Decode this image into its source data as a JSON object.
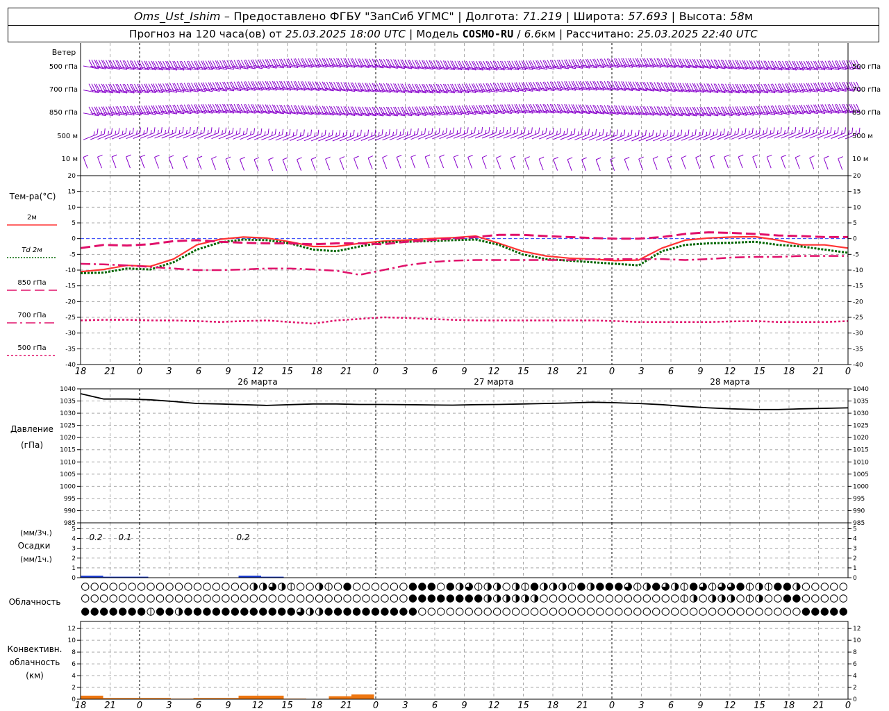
{
  "header": {
    "station": "Oms_Ust_Ishim",
    "dash": "–",
    "provided_by": "Предоставлено ФГБУ \"ЗапСиб УГМС\"",
    "lon_label": "Долгота:",
    "lon_value": "71.219",
    "lat_label": "Широта:",
    "lat_value": "57.693",
    "alt_label": "Высота:",
    "alt_value": "58",
    "alt_unit": "м",
    "sep": "|",
    "forecast_label": "Прогноз на 120 часа(ов) от",
    "forecast_start": "25.03.2025 18:00 UTC",
    "model_label": "Модель",
    "model_name": "COSMO-RU",
    "model_slash": "/",
    "model_res": "6.6",
    "model_res_unit": "км",
    "computed_label": "Рассчитано:",
    "computed_time": "25.03.2025 22:40 UTC"
  },
  "panels": {
    "wind": {
      "title": "Ветер",
      "levels": [
        "500 гПа",
        "700 гПа",
        "850 гПа",
        "500 м",
        "10  м"
      ],
      "color": "#8800cc"
    },
    "temperature": {
      "title": "Тем-ра(°С)",
      "legend": [
        {
          "label": "2м",
          "color": "#ff3333",
          "dash": "solid"
        },
        {
          "label": "Td  2м",
          "color": "#006600",
          "dash": "dot"
        },
        {
          "label": "850 гПа",
          "color": "#e0106a",
          "dash": "longdash"
        },
        {
          "label": "700 гПа",
          "color": "#e0106a",
          "dash": "dashdot"
        },
        {
          "label": "500 гПа",
          "color": "#e0106a",
          "dash": "shortdot"
        }
      ],
      "yticks": [
        20,
        15,
        10,
        5,
        0,
        -5,
        -10,
        -15,
        -20,
        -25,
        -30,
        -35,
        -40
      ]
    },
    "pressure": {
      "title": "Давление",
      "unit": "(гПа)",
      "yticks": [
        1040,
        1035,
        1030,
        1025,
        1020,
        1015,
        1010,
        1005,
        1000,
        995,
        990,
        985
      ]
    },
    "precip": {
      "label_top": "(мм/3ч.)",
      "title": "Осадки",
      "label_bottom": "(мм/1ч.)",
      "yticks": [
        5,
        4,
        3,
        2,
        1,
        0
      ],
      "annotations": [
        "0.2",
        "0.1",
        "0.2"
      ]
    },
    "clouds": {
      "title": "Облачность"
    },
    "convective": {
      "title_lines": [
        "Конвективн.",
        "облачность",
        "(км)"
      ],
      "yticks": [
        12,
        10,
        8,
        6,
        4,
        2,
        0
      ]
    }
  },
  "time_axis": {
    "hour_labels": [
      "18",
      "21",
      "0",
      "3",
      "6",
      "9",
      "12",
      "15",
      "18",
      "21",
      "0",
      "3",
      "6",
      "9",
      "12",
      "15",
      "18",
      "21",
      "0",
      "3",
      "6",
      "9",
      "12",
      "15",
      "18",
      "21",
      "0"
    ],
    "day_labels": [
      "26 марта",
      "27 марта",
      "28 марта"
    ]
  },
  "chart_data": [
    {
      "type": "line",
      "title": "Тем-ра(°С)",
      "x_unit": "hours since 25.03.2025 18:00 UTC",
      "x": [
        0,
        3,
        6,
        9,
        12,
        15,
        18,
        21,
        24,
        27,
        30,
        33,
        36,
        39,
        42,
        45,
        48,
        51,
        54,
        57,
        60,
        63,
        66,
        69,
        72,
        75,
        78
      ],
      "ylim": [
        -40,
        20
      ],
      "series": [
        {
          "name": "2м",
          "values": [
            -10.5,
            -9.8,
            -8.5,
            -8.8,
            -6.5,
            -2.0,
            -0.2,
            0.5,
            0.2,
            -1.0,
            -2.5,
            -2.5,
            -1.5,
            -0.8,
            -0.5,
            0.0,
            0.3,
            0.8,
            -1.5,
            -4.0,
            -5.5,
            -6.2,
            -6.5,
            -7.0,
            -6.8,
            -3.0,
            -0.5,
            0.2,
            0.5,
            0.6,
            -0.5,
            -2.0,
            -2.0,
            -3.0
          ]
        },
        {
          "name": "Td  2м",
          "values": [
            -11.0,
            -10.8,
            -9.5,
            -9.8,
            -7.5,
            -3.5,
            -1.2,
            -0.3,
            -0.5,
            -1.5,
            -3.5,
            -4.0,
            -2.5,
            -1.2,
            -1.0,
            -0.8,
            -0.5,
            -0.3,
            -2.0,
            -5.0,
            -6.5,
            -7.0,
            -7.5,
            -8.0,
            -8.5,
            -4.0,
            -2.0,
            -1.5,
            -1.3,
            -1.0,
            -2.0,
            -2.5,
            -3.5,
            -4.5
          ]
        },
        {
          "name": "850 гПа",
          "values": [
            -3.0,
            -2.0,
            -2.2,
            -1.8,
            -0.8,
            -0.5,
            -1.0,
            -1.3,
            -1.5,
            -1.5,
            -1.8,
            -1.5,
            -1.5,
            -1.8,
            -1.0,
            -0.5,
            0.0,
            0.5,
            1.2,
            1.2,
            0.8,
            0.5,
            0.2,
            0.0,
            0.0,
            0.5,
            1.5,
            2.0,
            1.8,
            1.5,
            1.0,
            0.8,
            0.5,
            0.5
          ]
        },
        {
          "name": "700 гПа",
          "values": [
            -8.0,
            -8.2,
            -8.5,
            -9.0,
            -9.5,
            -10.0,
            -10.0,
            -9.8,
            -9.5,
            -9.5,
            -9.8,
            -10.2,
            -11.5,
            -10.0,
            -8.5,
            -7.5,
            -7.0,
            -6.8,
            -6.8,
            -6.8,
            -6.8,
            -6.8,
            -6.5,
            -6.5,
            -6.5,
            -6.5,
            -6.8,
            -6.5,
            -6.0,
            -5.8,
            -5.8,
            -5.5,
            -5.5,
            -5.5
          ]
        },
        {
          "name": "500 гПа",
          "values": [
            -26.0,
            -25.8,
            -25.8,
            -26.0,
            -26.0,
            -26.2,
            -26.5,
            -26.2,
            -26.0,
            -26.5,
            -27.0,
            -26.0,
            -25.5,
            -25.0,
            -25.2,
            -25.5,
            -25.8,
            -26.0,
            -26.0,
            -26.0,
            -26.0,
            -26.0,
            -26.0,
            -26.2,
            -26.5,
            -26.5,
            -26.5,
            -26.5,
            -26.3,
            -26.2,
            -26.5,
            -26.5,
            -26.5,
            -26.2
          ]
        }
      ]
    },
    {
      "type": "line",
      "title": "Давление",
      "ylabel": "(гПа)",
      "ylim": [
        985,
        1040
      ],
      "series": [
        {
          "name": "Давление",
          "values": [
            1038.0,
            1035.8,
            1035.8,
            1035.5,
            1034.8,
            1034.0,
            1033.8,
            1033.5,
            1033.2,
            1033.5,
            1033.8,
            1033.8,
            1033.6,
            1033.6,
            1033.5,
            1033.4,
            1033.3,
            1033.5,
            1033.6,
            1033.8,
            1034.0,
            1034.2,
            1034.5,
            1034.3,
            1034.0,
            1033.5,
            1032.8,
            1032.2,
            1031.8,
            1031.5,
            1031.5,
            1031.8,
            1032.0,
            1032.2
          ]
        }
      ]
    },
    {
      "type": "bar",
      "title": "Осадки",
      "ylabel": "(мм/1ч.)",
      "ylim": [
        0,
        5
      ],
      "series": [
        {
          "name": "Осадки",
          "values": [
            0.2,
            0.1,
            0.1,
            0,
            0,
            0,
            0,
            0.2,
            0.1,
            0,
            0,
            0,
            0,
            0,
            0,
            0,
            0,
            0,
            0,
            0,
            0,
            0,
            0,
            0,
            0,
            0,
            0,
            0,
            0,
            0,
            0,
            0,
            0,
            0
          ]
        }
      ]
    },
    {
      "type": "bar",
      "title": "Конвективн. облачность",
      "ylabel": "(км)",
      "ylim": [
        0,
        13
      ],
      "series": [
        {
          "name": "Конвективн. облачность",
          "values": [
            0.6,
            0.2,
            0.2,
            0.2,
            0.1,
            0.2,
            0.2,
            0.6,
            0.6,
            0.1,
            0,
            0.5,
            0.8,
            0,
            0,
            0,
            0,
            0,
            0,
            0,
            0,
            0,
            0,
            0,
            0,
            0,
            0,
            0,
            0,
            0,
            0,
            0,
            0,
            0
          ]
        }
      ]
    }
  ]
}
